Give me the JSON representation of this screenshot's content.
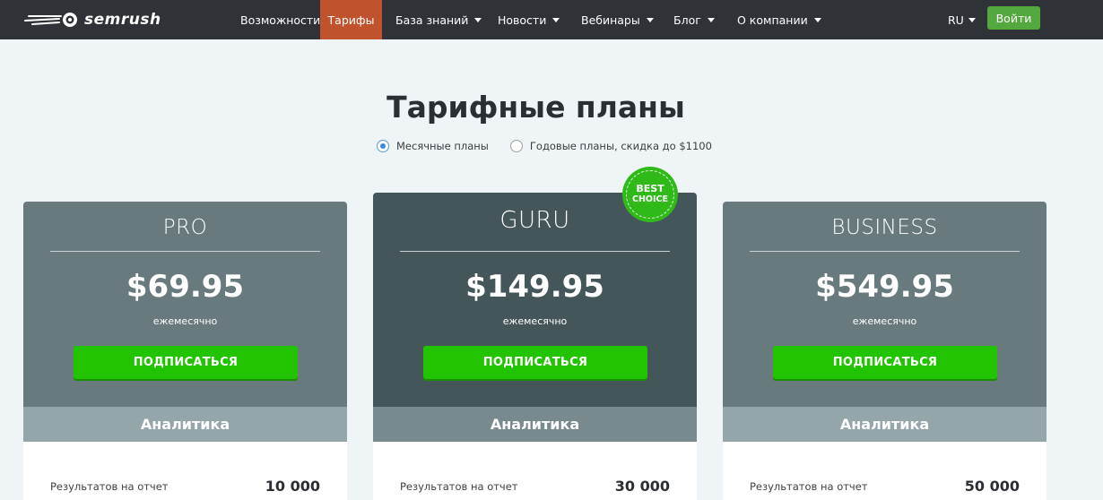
{
  "brand": {
    "name": "semrush",
    "icon": "fireball-icon"
  },
  "nav": {
    "items": [
      {
        "label": "Возможности",
        "dropdown": false,
        "active": false
      },
      {
        "label": "Тарифы",
        "dropdown": false,
        "active": true
      },
      {
        "label": "База знаний",
        "dropdown": true,
        "active": false
      },
      {
        "label": "Новости",
        "dropdown": true,
        "active": false
      },
      {
        "label": "Вебинары",
        "dropdown": true,
        "active": false
      },
      {
        "label": "Блог",
        "dropdown": true,
        "active": false
      },
      {
        "label": "О компании",
        "dropdown": true,
        "active": false
      }
    ],
    "lang": "RU",
    "login_label": "Войти"
  },
  "page": {
    "title": "Тарифные планы",
    "billing_options": [
      {
        "label": "Месячные планы",
        "checked": true
      },
      {
        "label": "Годовые планы, скидка до $1100",
        "checked": false
      }
    ]
  },
  "plans": [
    {
      "name": "PRO",
      "price": "$69.95",
      "period": "ежемесячно",
      "cta": "ПОДПИСАТЬСЯ",
      "section": "Аналитика",
      "row_label": "Результатов на отчет",
      "row_value": "10 000"
    },
    {
      "name": "GURU",
      "price": "$149.95",
      "period": "ежемесячно",
      "cta": "ПОДПИСАТЬСЯ",
      "section": "Аналитика",
      "row_label": "Результатов на отчет",
      "row_value": "30 000",
      "badge": [
        "BEST",
        "CHOICE"
      ]
    },
    {
      "name": "BUSINESS",
      "price": "$549.95",
      "period": "ежемесячно",
      "cta": "ПОДПИСАТЬСЯ",
      "section": "Аналитика",
      "row_label": "Результатов на отчет",
      "row_value": "50 000"
    }
  ],
  "colors": {
    "nav_bg": "#2f3337",
    "nav_active": "#c0522e",
    "login": "#54a93e",
    "cta": "#22c300",
    "card_head": "#687a7e",
    "card_head_featured": "#445659",
    "badge": "#2fba1a"
  }
}
